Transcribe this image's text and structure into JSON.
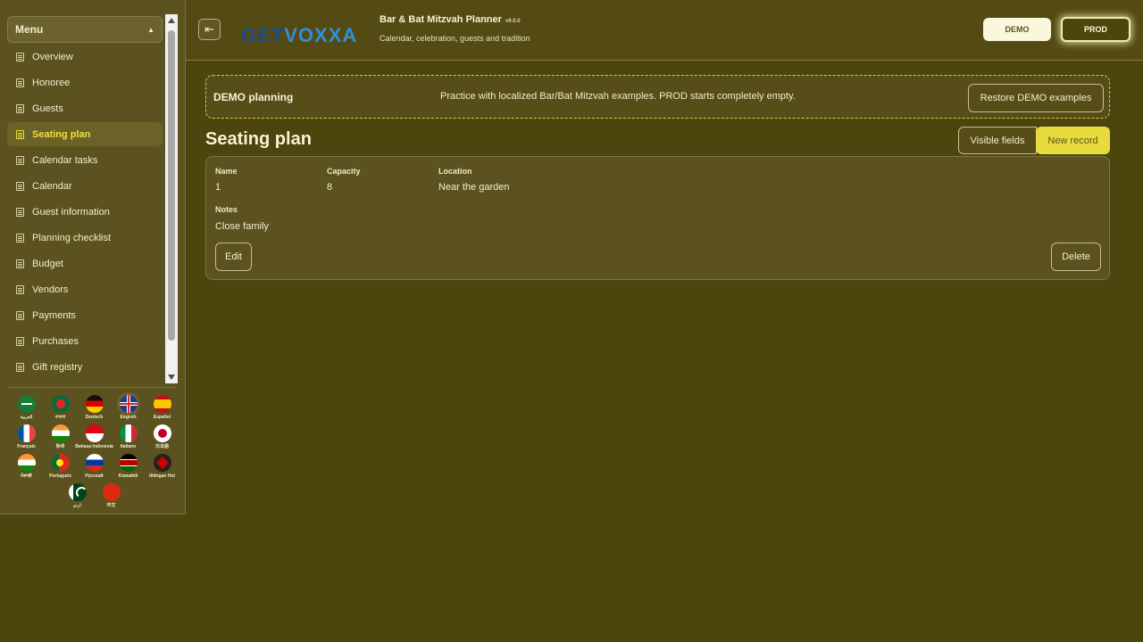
{
  "app": {
    "title": "Bar & Bat Mitzvah Planner",
    "version": "v9.0.0",
    "subtitle": "Calendar, celebration, guests and tradition",
    "logo_text_a": "GET",
    "logo_text_b": "VOXXA"
  },
  "header": {
    "collapse_icon": "sidebar-collapse-icon",
    "demo_label": "DEMO",
    "prod_label": "PROD"
  },
  "sidebar": {
    "menu_title": "Menu",
    "items": [
      {
        "label": "Overview",
        "active": false
      },
      {
        "label": "Honoree",
        "active": false
      },
      {
        "label": "Guests",
        "active": false
      },
      {
        "label": "Seating plan",
        "active": true
      },
      {
        "label": "Calendar tasks",
        "active": false
      },
      {
        "label": "Calendar",
        "active": false
      },
      {
        "label": "Guest information",
        "active": false
      },
      {
        "label": "Planning checklist",
        "active": false
      },
      {
        "label": "Budget",
        "active": false
      },
      {
        "label": "Vendors",
        "active": false
      },
      {
        "label": "Payments",
        "active": false
      },
      {
        "label": "Purchases",
        "active": false
      },
      {
        "label": "Gift registry",
        "active": false
      }
    ],
    "languages": [
      {
        "label": "العربية"
      },
      {
        "label": "বাংলা"
      },
      {
        "label": "Deutsch"
      },
      {
        "label": "English"
      },
      {
        "label": "Español"
      },
      {
        "label": "Français"
      },
      {
        "label": "हिन्दी"
      },
      {
        "label": "Bahasa Indonesia"
      },
      {
        "label": "Italiano"
      },
      {
        "label": "日本語"
      },
      {
        "label": "ਪੰਜਾਬੀ"
      },
      {
        "label": "Português"
      },
      {
        "label": "Русский"
      },
      {
        "label": "Kiswahili"
      },
      {
        "label": "tlhIngan Hol"
      },
      {
        "label": "اردو"
      },
      {
        "label": "中文"
      }
    ]
  },
  "banner": {
    "title": "DEMO planning",
    "text": "Practice with localized Bar/Bat Mitzvah examples. PROD starts completely empty.",
    "restore_label": "Restore DEMO examples"
  },
  "page": {
    "title": "Seating plan",
    "visible_fields_label": "Visible fields",
    "new_record_label": "New record"
  },
  "record": {
    "name_label": "Name",
    "name_value": "1",
    "capacity_label": "Capacity",
    "capacity_value": "8",
    "location_label": "Location",
    "location_value": "Near the garden",
    "notes_label": "Notes",
    "notes_value": "Close family",
    "edit_label": "Edit",
    "delete_label": "Delete"
  },
  "colors": {
    "background": "#4c450d",
    "panel": "#5b5220",
    "accent": "#e8dc3c",
    "active_text": "#f1e23a"
  }
}
